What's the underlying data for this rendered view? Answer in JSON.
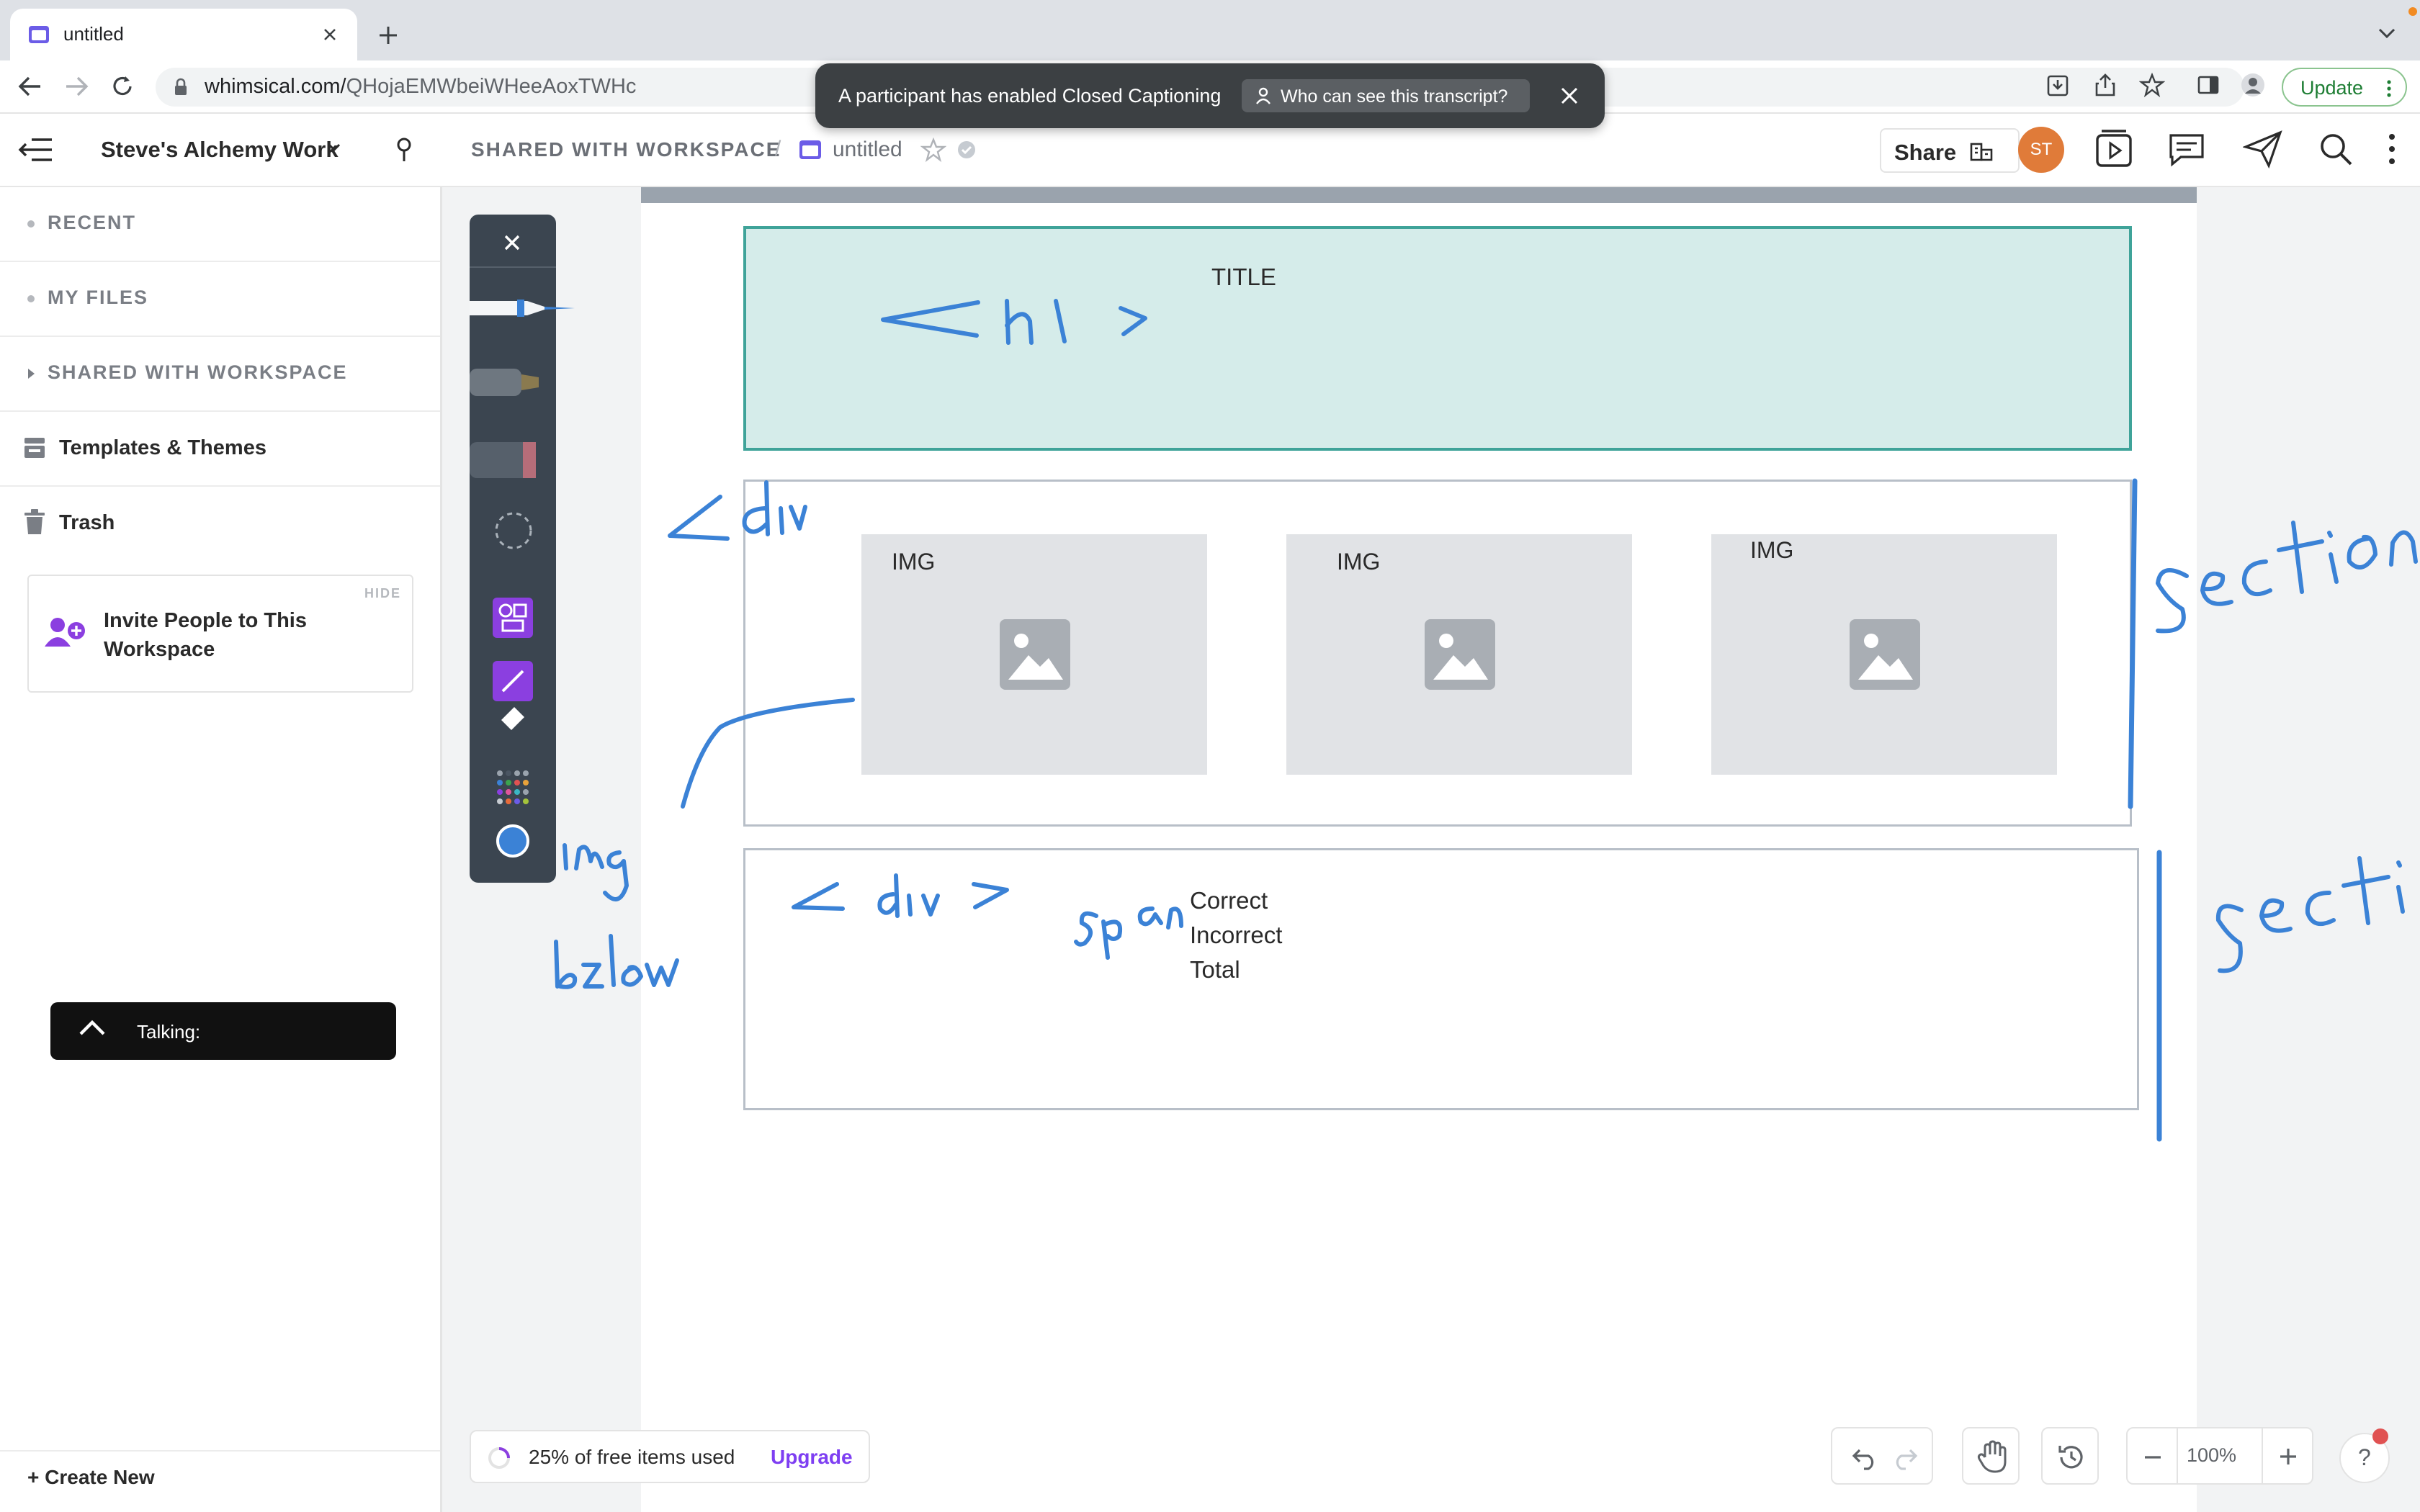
{
  "browser": {
    "tab_title": "untitled",
    "url_host": "whimsical.com/",
    "url_path": "QHojaEMWbeiWHeeAoxTWHc",
    "update_label": "Update"
  },
  "caption_banner": {
    "message": "A participant has enabled Closed Captioning",
    "pill_label": "Who can see this transcript?"
  },
  "header": {
    "workspace_name": "Steve's Alchemy Work",
    "breadcrumb_root": "SHARED WITH WORKSPACE",
    "breadcrumb_separator": "/",
    "document_title": "untitled",
    "share_label": "Share",
    "avatar_initials": "ST"
  },
  "sidebar": {
    "sections": [
      {
        "label": "RECENT"
      },
      {
        "label": "MY FILES"
      },
      {
        "label": "SHARED WITH WORKSPACE"
      }
    ],
    "items": [
      {
        "label": "Templates & Themes",
        "icon": "templates-icon"
      },
      {
        "label": "Trash",
        "icon": "trash-icon"
      }
    ],
    "invite": {
      "text": "Invite People to This Workspace",
      "hide_label": "HIDE"
    },
    "talking_label": "Talking:",
    "create_new_label": "Create New"
  },
  "canvas": {
    "title_box_text": "TITLE",
    "image_labels": [
      "IMG",
      "IMG",
      "IMG"
    ],
    "span_lines": [
      "Correct",
      "Incorrect",
      "Total"
    ],
    "handwriting": [
      "<h1 >",
      "<div",
      "< div >",
      "span",
      "section",
      "secti",
      "img below"
    ],
    "ink_color": "#3b82d6",
    "title_fill": "#d5ecea",
    "title_border": "#3fa399"
  },
  "drawing_toolbar": {
    "tools": [
      "close-icon",
      "pen-tool",
      "marker-tool",
      "eraser-tool",
      "lasso-tool",
      "shapes-tool",
      "line-tool",
      "eraser-small-tool",
      "palette-tool",
      "color-swatch"
    ],
    "active_color": "#3b82d6",
    "accent_color": "#8b3fe0"
  },
  "footer": {
    "usage_text": "25% of free items used",
    "upgrade_label": "Upgrade",
    "zoom": "100%",
    "help_label": "?"
  }
}
